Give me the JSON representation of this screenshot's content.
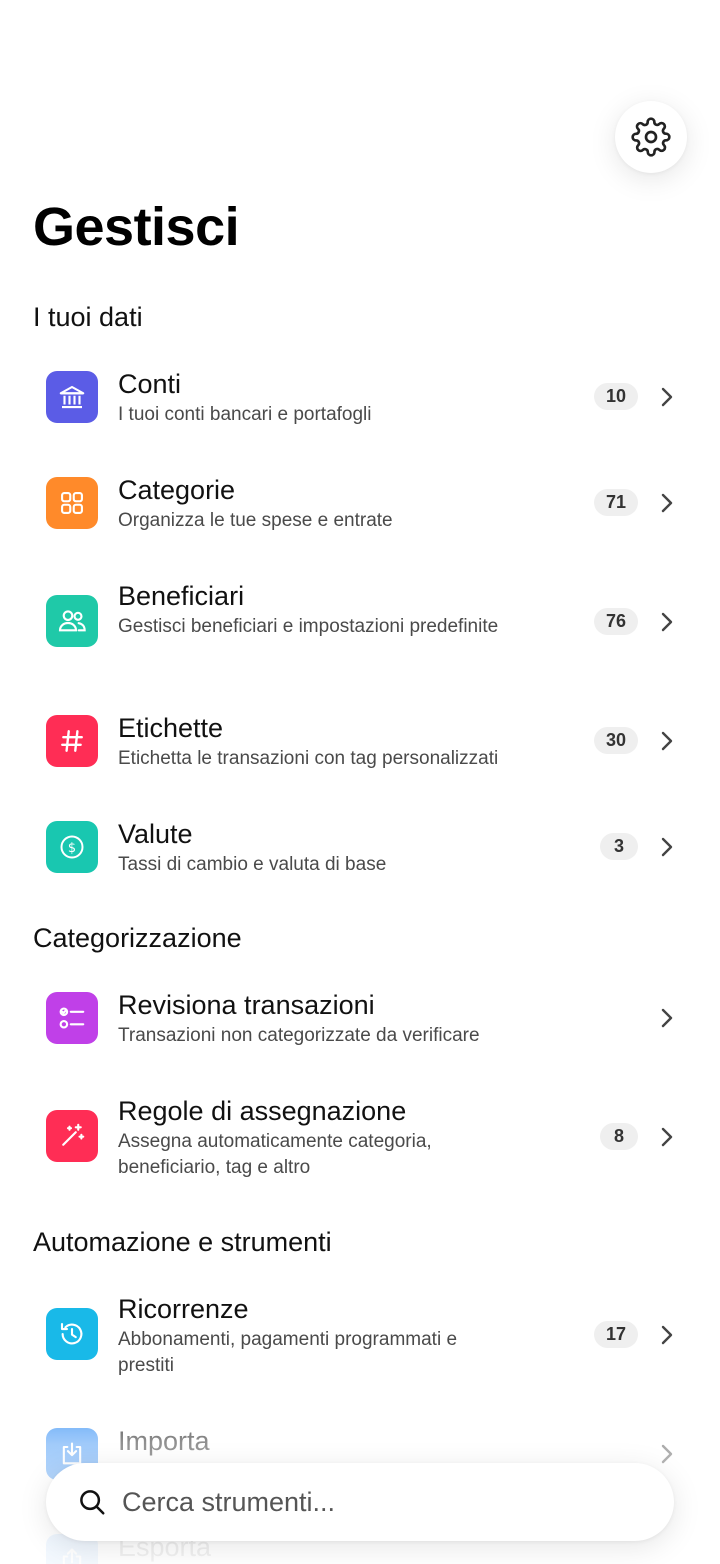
{
  "page": {
    "title": "Gestisci"
  },
  "settings": {
    "icon": "gear-icon"
  },
  "sections": [
    {
      "title": "I tuoi dati"
    },
    {
      "title": "Categorizzazione"
    },
    {
      "title": "Automazione e strumenti"
    }
  ],
  "items": [
    {
      "key": "conti",
      "title": "Conti",
      "subtitle": "I tuoi conti bancari e portafogli",
      "count": "10",
      "icon": "bank-icon",
      "color": "#5B5CE6"
    },
    {
      "key": "categorie",
      "title": "Categorie",
      "subtitle": "Organizza le tue spese e entrate",
      "count": "71",
      "icon": "grid-icon",
      "color": "#FF8A2A"
    },
    {
      "key": "beneficiari",
      "title": "Beneficiari",
      "subtitle": "Gestisci beneficiari e impostazioni predefinite",
      "count": "76",
      "icon": "people-icon",
      "color": "#1FC9A8"
    },
    {
      "key": "etichette",
      "title": "Etichette",
      "subtitle": "Etichetta le transazioni con tag personalizzati",
      "count": "30",
      "icon": "hashtag-icon",
      "color": "#FF2D55"
    },
    {
      "key": "valute",
      "title": "Valute",
      "subtitle": "Tassi di cambio e valuta di base",
      "count": "3",
      "icon": "dollar-coin-icon",
      "color": "#19C7B0"
    },
    {
      "key": "revisiona",
      "title": "Revisiona transazioni",
      "subtitle": "Transazioni non categorizzate da verificare",
      "count": "",
      "icon": "checklist-icon",
      "color": "#C040E8"
    },
    {
      "key": "regole",
      "title": "Regole di assegnazione",
      "subtitle": "Assegna automaticamente categoria, beneficiario, tag e altro",
      "count": "8",
      "icon": "magic-wand-icon",
      "color": "#FF2D55"
    },
    {
      "key": "ricorrenze",
      "title": "Ricorrenze",
      "subtitle": "Abbonamenti, pagamenti programmati e prestiti",
      "count": "17",
      "icon": "recurring-clock-icon",
      "color": "#19B9E8"
    },
    {
      "key": "importa",
      "title": "Importa",
      "subtitle": "",
      "count": "",
      "icon": "import-icon",
      "color": "#2F8CF5"
    },
    {
      "key": "esporta",
      "title": "Esporta",
      "subtitle": "",
      "count": "",
      "icon": "export-icon",
      "color": "#2F8CF5"
    }
  ],
  "search": {
    "placeholder": "Cerca strumenti...",
    "value": ""
  }
}
